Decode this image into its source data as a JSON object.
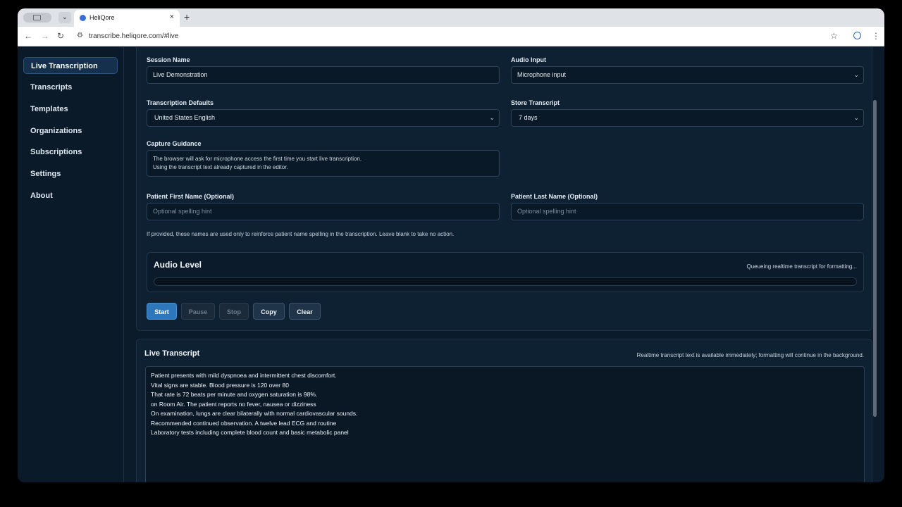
{
  "browser": {
    "tab_title": "HeliQore",
    "tab_close": "×",
    "new_tab": "+",
    "url": "transcribe.heliqore.com/#live"
  },
  "sidebar": {
    "items": [
      {
        "label": "Live Transcription",
        "active": true
      },
      {
        "label": "Transcripts"
      },
      {
        "label": "Templates"
      },
      {
        "label": "Organizations"
      },
      {
        "label": "Subscriptions"
      },
      {
        "label": "Settings"
      },
      {
        "label": "About"
      }
    ]
  },
  "form": {
    "session_name_label": "Session Name",
    "session_name_value": "Live Demonstration",
    "audio_input_label": "Audio Input",
    "audio_input_value": "Microphone input",
    "defaults_label": "Transcription Defaults",
    "defaults_value": "United States English",
    "store_label": "Store Transcript",
    "store_value": "7 days",
    "guidance_label": "Capture Guidance",
    "guidance_lines": [
      "The browser will ask for microphone access the first time you start live transcription.",
      "Using the transcript text already captured in the editor."
    ],
    "first_name_label": "Patient First Name (Optional)",
    "first_name_placeholder": "Optional spelling hint",
    "last_name_label": "Patient Last Name (Optional)",
    "last_name_placeholder": "Optional spelling hint",
    "hint": "If provided, these names are used only to reinforce patient name spelling in the transcription. Leave blank to take no action."
  },
  "audio": {
    "title": "Audio Level",
    "status": "Queueing realtime transcript for formatting...",
    "level": 0
  },
  "controls": {
    "start": "Start",
    "pause": "Pause",
    "stop": "Stop",
    "copy": "Copy",
    "clear": "Clear"
  },
  "live_transcript": {
    "title": "Live Transcript",
    "note": "Realtime transcript text is available immediately; formatting will continue in the background.",
    "lines": [
      "Patient presents with mild dyspnoea and intermittent chest discomfort.",
      "Vital signs are stable. Blood pressure is 120 over 80",
      "That rate is 72 beats per minute and oxygen saturation is 98%.",
      "on Room Air. The patient reports no fever, nausea or dizziness",
      "On examination, lungs are clear bilaterally with normal cardiovascular sounds.",
      "Recommended continued observation. A twelve lead ECG and routine",
      "Laboratory tests including complete blood count and basic metabolic panel"
    ]
  },
  "colors": {
    "accent": "#2d77ba",
    "background": "#0c1b2a",
    "panel": "#0e2133"
  }
}
